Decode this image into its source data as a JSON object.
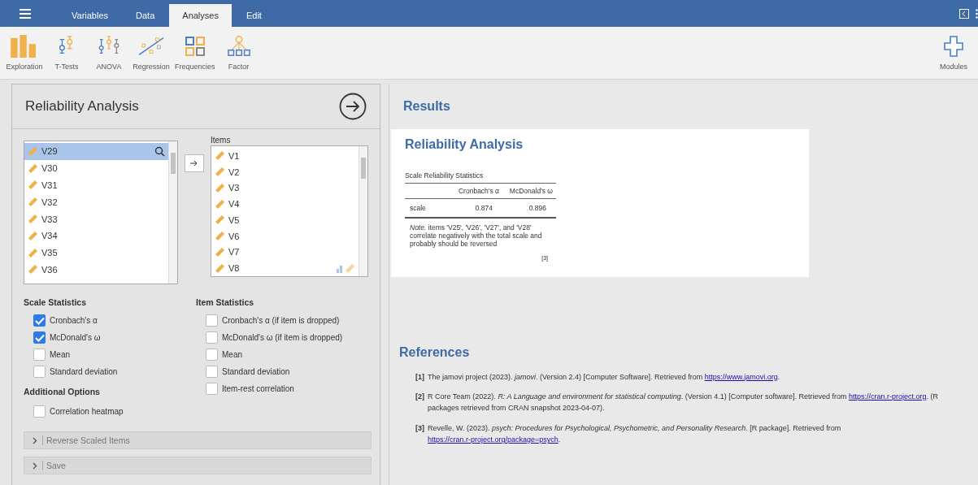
{
  "menu_tabs": [
    {
      "label": "Variables",
      "selected": false
    },
    {
      "label": "Data",
      "selected": false
    },
    {
      "label": "Analyses",
      "selected": true
    },
    {
      "label": "Edit",
      "selected": false
    }
  ],
  "ribbon": [
    {
      "label": "Exploration",
      "kind": "bars"
    },
    {
      "label": "T-Tests",
      "kind": "ttest"
    },
    {
      "label": "ANOVA",
      "kind": "anova"
    },
    {
      "label": "Regression",
      "kind": "regression"
    },
    {
      "label": "Frequencies",
      "kind": "frequencies"
    },
    {
      "label": "Factor",
      "kind": "factor"
    }
  ],
  "modules": {
    "label": "Modules"
  },
  "analysis_panel": {
    "title": "Reliability Analysis",
    "variables": [
      {
        "name": "V29",
        "selected": true
      },
      {
        "name": "V30",
        "selected": false
      },
      {
        "name": "V31",
        "selected": false
      },
      {
        "name": "V32",
        "selected": false
      },
      {
        "name": "V33",
        "selected": false
      },
      {
        "name": "V34",
        "selected": false
      },
      {
        "name": "V35",
        "selected": false
      },
      {
        "name": "V36",
        "selected": false
      }
    ],
    "items_label": "Items",
    "items": [
      "V1",
      "V2",
      "V3",
      "V4",
      "V5",
      "V6",
      "V7",
      "V8"
    ],
    "scale_statistics": {
      "title": "Scale Statistics",
      "options": [
        {
          "label": "Cronbach's α",
          "checked": true
        },
        {
          "label": "McDonald's ω",
          "checked": true
        },
        {
          "label": "Mean",
          "checked": false
        },
        {
          "label": "Standard deviation",
          "checked": false
        }
      ]
    },
    "additional_options": {
      "title": "Additional Options",
      "options": [
        {
          "label": "Correlation heatmap",
          "checked": false
        }
      ]
    },
    "item_statistics": {
      "title": "Item Statistics",
      "options": [
        {
          "label": "Cronbach's α (if item is dropped)",
          "checked": false
        },
        {
          "label": "McDonald's ω (if item is dropped)",
          "checked": false
        },
        {
          "label": "Mean",
          "checked": false
        },
        {
          "label": "Standard deviation",
          "checked": false
        },
        {
          "label": "Item-rest correlation",
          "checked": false
        }
      ]
    },
    "sections": [
      {
        "label": "Reverse Scaled Items",
        "expanded": false
      },
      {
        "label": "Save",
        "expanded": false
      }
    ]
  },
  "results": {
    "heading": "Results",
    "title": "Reliability Analysis",
    "table": {
      "title": "Scale Reliability Statistics",
      "columns": [
        "Cronbach's α",
        "McDonald's ω"
      ],
      "rows": [
        {
          "label": "scale",
          "values": [
            "0.874",
            "0.896"
          ]
        }
      ],
      "note": "*Note.* items 'V25', 'V26', 'V27', and 'V28' correlate negatively with the total scale and probably should be reversed",
      "ref": "[3]"
    }
  },
  "references": {
    "heading": "References",
    "items": [
      {
        "num": "[1]",
        "text": "The jamovi project (2023). *jamovi*. (Version 2.4) [Computer Software]. Retrieved from",
        "link": "https://www.jamovi.org",
        "after": "."
      },
      {
        "num": "[2]",
        "text": "R Core Team (2022). *R: A Language and environment for statistical computing*. (Version 4.1) [Computer software]. Retrieved from",
        "link": "https://cran.r-project.org",
        "after": ". (R packages retrieved from CRAN snapshot 2023-04-07)."
      },
      {
        "num": "[3]",
        "text": "Revelle, W. (2023). *psych: Procedures for Psychological, Psychometric, and Personality Research*. [R package]. Retrieved from",
        "link": "https://cran.r-project.org/package=psych",
        "after": "."
      }
    ]
  }
}
